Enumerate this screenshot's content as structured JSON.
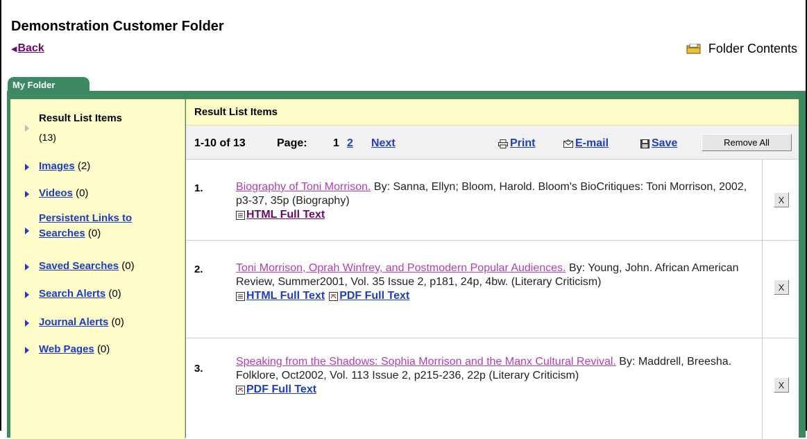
{
  "header": {
    "title": "Demonstration Customer Folder",
    "back_label": "Back",
    "folder_contents_label": "Folder Contents"
  },
  "tab": {
    "label": "My Folder"
  },
  "sidebar": {
    "items": [
      {
        "label": "Result List Items",
        "count": "(13)",
        "active": true
      },
      {
        "label": "Images",
        "count": "(2)"
      },
      {
        "label": "Videos",
        "count": "(0)"
      },
      {
        "label_line1": "Persistent Links to",
        "label_line2": "Searches",
        "count": "(0)"
      },
      {
        "label": "Saved Searches",
        "count": "(0)"
      },
      {
        "label": "Search Alerts",
        "count": "(0)"
      },
      {
        "label": "Journal Alerts",
        "count": "(0)"
      },
      {
        "label": "Web Pages",
        "count": "(0)"
      }
    ]
  },
  "content": {
    "heading": "Result List Items",
    "pager": {
      "range": "1-10 of 13",
      "page_label": "Page:",
      "current_page": "1",
      "next_page": "2",
      "next_label": "Next"
    },
    "actions": {
      "print": "Print",
      "email": "E-mail",
      "save": "Save",
      "remove_all": "Remove All"
    },
    "results": [
      {
        "num": "1.",
        "title": "Biography of Toni Morrison.",
        "citation": " By: Sanna, Ellyn; Bloom, Harold. Bloom's BioCritiques: Toni Morrison, 2002, p3-37, 35p (Biography)",
        "html_label": "HTML Full Text",
        "remove": "X"
      },
      {
        "num": "2.",
        "title": "Toni Morrison, Oprah Winfrey, and Postmodern Popular Audiences.",
        "citation": " By: Young, John. African American Review, Summer2001, Vol. 35 Issue 2, p181, 24p, 4bw. (Literary Criticism)",
        "html_label": "HTML Full Text",
        "pdf_label": "PDF Full Text",
        "remove": "X"
      },
      {
        "num": "3.",
        "title": "Speaking from the Shadows: Sophia Morrison and the Manx Cultural Revival.",
        "citation": " By: Maddrell, Breesha. Folklore, Oct2002, Vol. 113 Issue 2, p215-236, 22p (Literary Criticism)",
        "pdf_label": "PDF Full Text",
        "remove": "X"
      }
    ]
  },
  "colors": {
    "tab_green": "#3d8a62",
    "sidebar_yellow": "#fdfbc7",
    "link_blue": "#1e3cc8",
    "visited_purple": "#6a0a6a",
    "title_magenta": "#b43cb4"
  }
}
